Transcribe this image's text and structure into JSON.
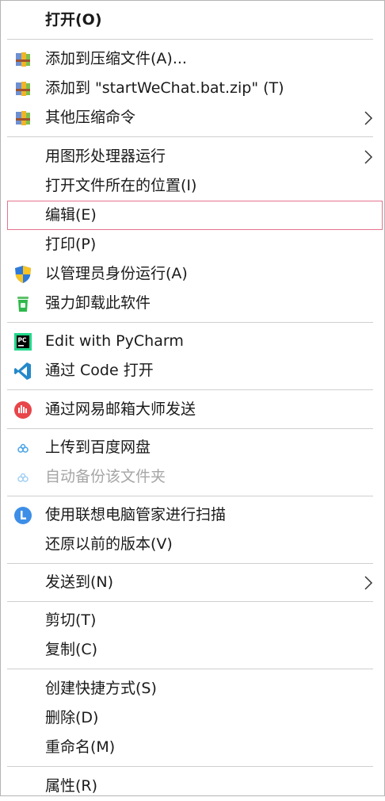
{
  "menu": {
    "open": "打开(O)",
    "add_archive": "添加到压缩文件(A)...",
    "add_to_zip": "添加到 \"startWeChat.bat.zip\" (T)",
    "other_compress": "其他压缩命令",
    "run_gpu": "用图形处理器运行",
    "open_location": "打开文件所在的位置(I)",
    "edit": "编辑(E)",
    "print": "打印(P)",
    "run_admin": "以管理员身份运行(A)",
    "force_uninstall": "强力卸载此软件",
    "edit_pycharm": "Edit with PyCharm",
    "open_code": "通过 Code 打开",
    "send_netease": "通过网易邮箱大师发送",
    "upload_baidu": "上传到百度网盘",
    "auto_backup": "自动备份该文件夹",
    "lenovo_scan": "使用联想电脑管家进行扫描",
    "restore_prev": "还原以前的版本(V)",
    "send_to": "发送到(N)",
    "cut": "剪切(T)",
    "copy": "复制(C)",
    "shortcut": "创建快捷方式(S)",
    "delete": "删除(D)",
    "rename": "重命名(M)",
    "properties": "属性(R)"
  },
  "colors": {
    "highlight_border": "#e4738f",
    "separator": "#cfcfcf",
    "disabled_text": "#a6a6a6",
    "text": "#1a1a1a"
  }
}
